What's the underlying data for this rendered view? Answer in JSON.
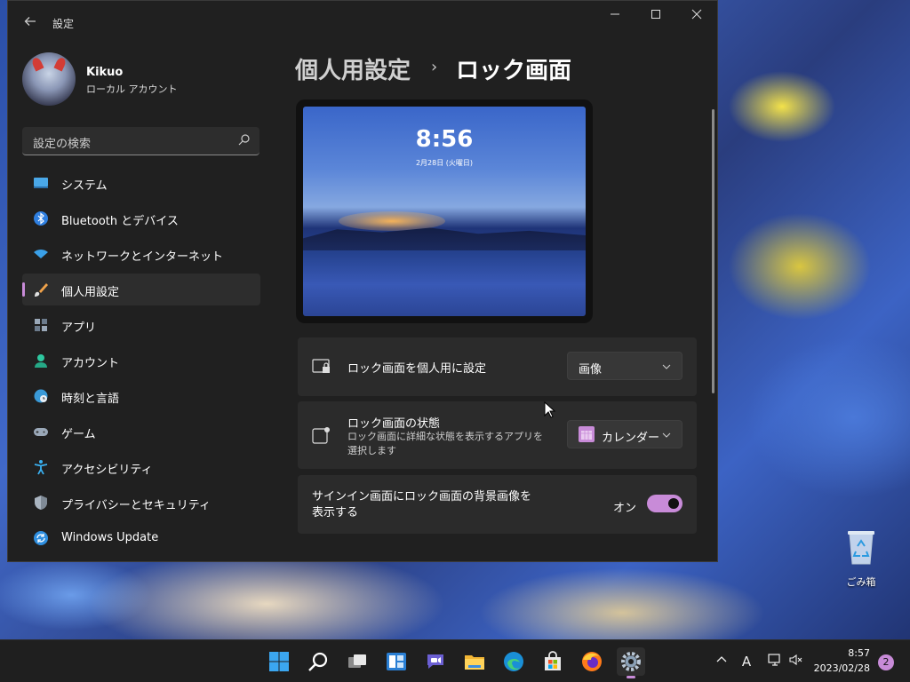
{
  "window": {
    "title": "設定",
    "controls": {
      "minimize": "—",
      "maximize": "☐",
      "close": "✕"
    }
  },
  "user": {
    "name": "Kikuo",
    "account_type": "ローカル アカウント"
  },
  "search": {
    "placeholder": "設定の検索"
  },
  "sidebar": {
    "items": [
      {
        "label": "システム",
        "icon": "monitor-icon",
        "active": false
      },
      {
        "label": "Bluetooth とデバイス",
        "icon": "bluetooth-icon",
        "active": false
      },
      {
        "label": "ネットワークとインターネット",
        "icon": "wifi-icon",
        "active": false
      },
      {
        "label": "個人用設定",
        "icon": "brush-icon",
        "active": true
      },
      {
        "label": "アプリ",
        "icon": "apps-icon",
        "active": false
      },
      {
        "label": "アカウント",
        "icon": "person-icon",
        "active": false
      },
      {
        "label": "時刻と言語",
        "icon": "globe-clock-icon",
        "active": false
      },
      {
        "label": "ゲーム",
        "icon": "gamepad-icon",
        "active": false
      },
      {
        "label": "アクセシビリティ",
        "icon": "accessibility-icon",
        "active": false
      },
      {
        "label": "プライバシーとセキュリティ",
        "icon": "shield-icon",
        "active": false
      },
      {
        "label": "Windows Update",
        "icon": "update-icon",
        "active": false
      }
    ]
  },
  "breadcrumb": {
    "parent": "個人用設定",
    "separator": "›",
    "current": "ロック画面"
  },
  "preview": {
    "time": "8:56",
    "date": "2月28日 (火曜日)"
  },
  "settings": {
    "personalize": {
      "title": "ロック画面を個人用に設定",
      "value": "画像"
    },
    "status": {
      "title": "ロック画面の状態",
      "description": "ロック画面に詳細な状態を表示するアプリを選択します",
      "value": "カレンダー"
    },
    "signin_background": {
      "title": "サインイン画面にロック画面の背景画像を表示する",
      "state_label": "オン",
      "enabled": true
    }
  },
  "desktop": {
    "recycle_bin_label": "ごみ箱"
  },
  "taskbar": {
    "apps": [
      "windows-start-icon",
      "search-icon",
      "task-view-icon",
      "widgets-icon",
      "teams-chat-icon",
      "file-explorer-icon",
      "edge-icon",
      "store-icon",
      "firefox-icon",
      "settings-icon"
    ],
    "tray": {
      "ime": "A"
    },
    "clock": {
      "time": "8:57",
      "date": "2023/02/28"
    },
    "notifications": "2"
  },
  "colors": {
    "accent": "#c88bd8",
    "window_bg": "#202020",
    "card_bg": "#2b2b2b"
  }
}
